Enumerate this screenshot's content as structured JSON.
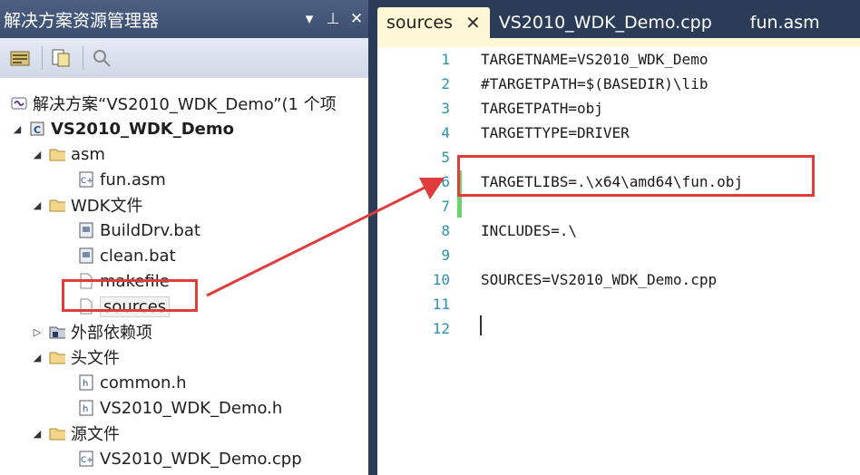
{
  "solution_explorer": {
    "title": "解决方案资源管理器",
    "controls": [
      "▾",
      "⊥",
      "✕"
    ],
    "toolbar_icons": [
      "properties-icon",
      "show-all-files-icon",
      "refresh-icon"
    ],
    "items": [
      {
        "label": "解决方案“VS2010_WDK_Demo”(1 个项",
        "toggle": "",
        "icon": "solution-icon"
      },
      {
        "label": "VS2010_WDK_Demo",
        "toggle": "◢",
        "icon": "project-icon"
      },
      {
        "label": "asm",
        "toggle": "◢",
        "icon": "folder-icon"
      },
      {
        "label": "fun.asm",
        "toggle": "",
        "icon": "cpp-file-icon"
      },
      {
        "label": "WDK文件",
        "toggle": "◢",
        "icon": "folder-icon"
      },
      {
        "label": "BuildDrv.bat",
        "toggle": "",
        "icon": "bat-file-icon"
      },
      {
        "label": "clean.bat",
        "toggle": "",
        "icon": "bat-file-icon"
      },
      {
        "label": "makefile",
        "toggle": "",
        "icon": "file-icon"
      },
      {
        "label": "sources",
        "toggle": "",
        "icon": "file-icon"
      },
      {
        "label": "外部依赖项",
        "toggle": "▷",
        "icon": "dependencies-icon"
      },
      {
        "label": "头文件",
        "toggle": "◢",
        "icon": "folder-icon"
      },
      {
        "label": "common.h",
        "toggle": "",
        "icon": "header-file-icon"
      },
      {
        "label": "VS2010_WDK_Demo.h",
        "toggle": "",
        "icon": "header-file-icon"
      },
      {
        "label": "源文件",
        "toggle": "◢",
        "icon": "folder-icon"
      },
      {
        "label": "VS2010_WDK_Demo.cpp",
        "toggle": "",
        "icon": "cpp-file-icon"
      }
    ]
  },
  "editor": {
    "tabs": [
      {
        "label": "sources",
        "close": "✕",
        "active": true
      },
      {
        "label": "VS2010_WDK_Demo.cpp",
        "active": false
      },
      {
        "label": "fun.asm",
        "active": false
      }
    ],
    "line_numbers": [
      "1",
      "2",
      "3",
      "4",
      "5",
      "6",
      "7",
      "8",
      "9",
      "10",
      "11",
      "12"
    ],
    "lines": [
      "TARGETNAME=VS2010_WDK_Demo",
      "#TARGETPATH=$(BASEDIR)\\lib",
      "TARGETPATH=obj",
      "TARGETTYPE=DRIVER",
      "",
      "TARGETLIBS=.\\x64\\amd64\\fun.obj",
      "",
      "INCLUDES=.\\",
      "",
      "SOURCES=VS2010_WDK_Demo.cpp",
      "",
      ""
    ]
  },
  "colors": {
    "annotation": "#e03c3c",
    "line_number": "#2b91af",
    "change_marker": "#6ad66a",
    "chrome": "#2b3c59"
  }
}
